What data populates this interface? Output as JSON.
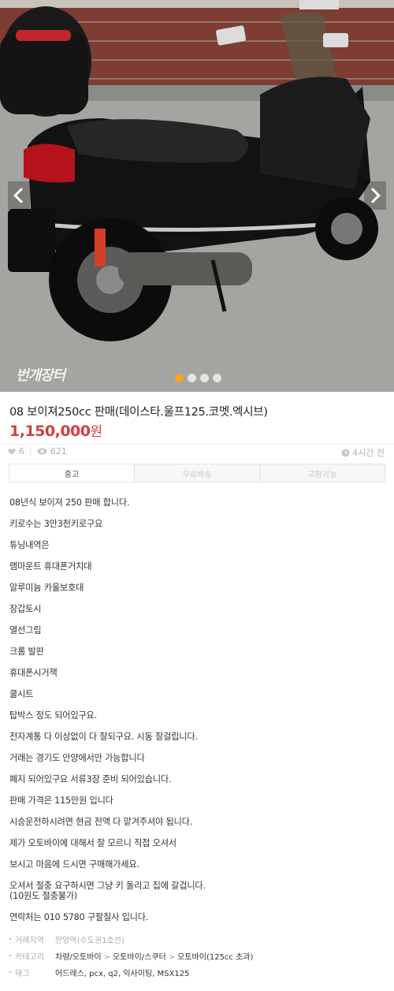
{
  "photo": {
    "watermark": "번개장터",
    "slides": 4,
    "active_slide": 1
  },
  "listing": {
    "title": "08 보이져250cc 판매(데이스타.울프125.코멧.엑시브)",
    "price": "1,150,000",
    "price_unit": "원",
    "likes": "6",
    "views": "621",
    "posted": "4시간 전"
  },
  "tabs": [
    "중고",
    "무료배송",
    "교환가능"
  ],
  "description": [
    "08년식 보이져 250 판매 합니다.",
    "키로수는 3만3천키로구요",
    "튜닝내역은",
    "램마운트 휴대폰거치대",
    "알루미늄 카울보호대",
    "장갑토시",
    "열선그립",
    "크롬 발판",
    "휴대폰시거잭",
    "쿨시트",
    "탑박스 정도 되어있구요.",
    "전자계통 다 이상없이 다 잘되구요. 시동 잘걸립니다.",
    "거래는 경기도 안양에서만 가능합니다",
    "폐지 되어있구요 서류3장 준비 되어있습니다.",
    "판매 가격은 115만원 입니다",
    "시승운전하시려면 현금 전액 다 맡겨주셔야 됩니다.",
    "제가 오토바이에 대해서 잘 모르니 직접 오셔서",
    "보시고 마음에 드시면 구매해가세요.",
    "오셔서 절충 요구하시면 그냥 키 돌리고 집에 갈겁니다.",
    "(10원도 절충불가)",
    "연락처는 010 5780 구팔칠사 입니다."
  ],
  "meta": {
    "location_label": "거래지역",
    "location": "안양역(수도권1호선)",
    "category_label": "카테고리",
    "category": [
      "차량/오토바이",
      "오토바이/스쿠터",
      "오토바이(125cc 초과)"
    ],
    "tags_label": "태그",
    "tags": "어드레스, pcx, q2, 익사이팅, MSX125"
  },
  "colors": {
    "price": "#d23f3f",
    "active_dot": "#f5a623"
  }
}
